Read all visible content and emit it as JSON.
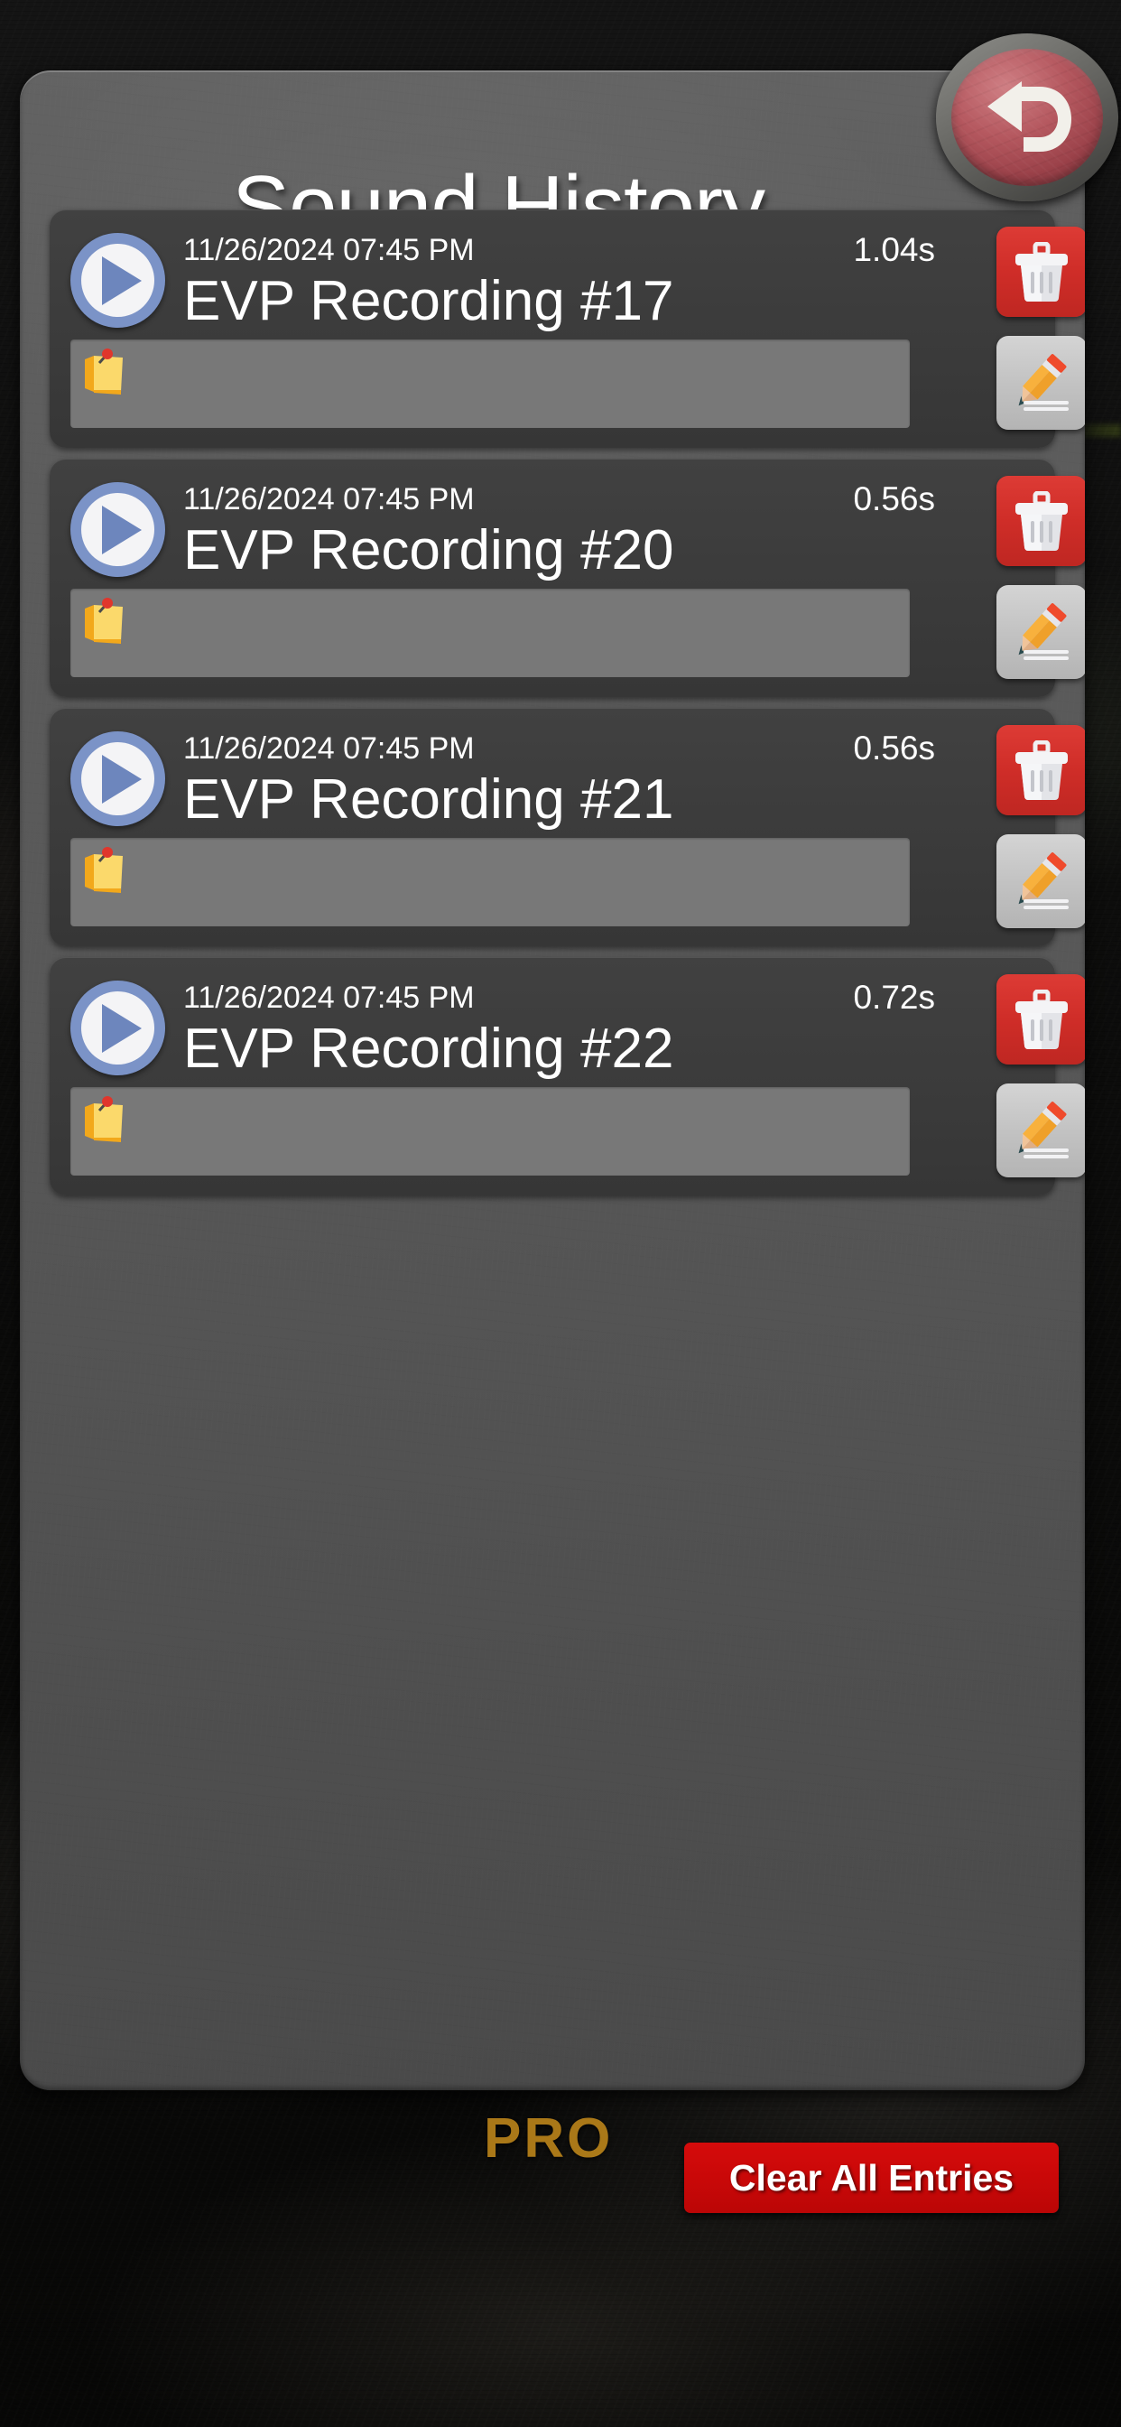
{
  "app": {
    "watermark": "PRO"
  },
  "header": {
    "title": "Sound History",
    "back_icon": "back-arrow-icon"
  },
  "colors": {
    "panel": "#585858",
    "card": "#3b3b3b",
    "note_field": "#787878",
    "delete_red": "#cf2d28",
    "clear_red": "#c80808",
    "play_blue": "#7b93c7",
    "watermark_gold": "#b8821a"
  },
  "recordings": [
    {
      "timestamp": "11/26/2024 07:45 PM",
      "duration": "1.04s",
      "title": "EVP Recording #17",
      "note": "",
      "note_icon": "sticky-note-icon",
      "play_icon": "play-icon",
      "delete_icon": "trash-icon",
      "edit_icon": "pencil-icon"
    },
    {
      "timestamp": "11/26/2024 07:45 PM",
      "duration": "0.56s",
      "title": "EVP Recording #20",
      "note": "",
      "note_icon": "sticky-note-icon",
      "play_icon": "play-icon",
      "delete_icon": "trash-icon",
      "edit_icon": "pencil-icon"
    },
    {
      "timestamp": "11/26/2024 07:45 PM",
      "duration": "0.56s",
      "title": "EVP Recording #21",
      "note": "",
      "note_icon": "sticky-note-icon",
      "play_icon": "play-icon",
      "delete_icon": "trash-icon",
      "edit_icon": "pencil-icon"
    },
    {
      "timestamp": "11/26/2024 07:45 PM",
      "duration": "0.72s",
      "title": "EVP Recording #22",
      "note": "",
      "note_icon": "sticky-note-icon",
      "play_icon": "play-icon",
      "delete_icon": "trash-icon",
      "edit_icon": "pencil-icon"
    }
  ],
  "footer": {
    "clear_all_label": "Clear All Entries"
  }
}
